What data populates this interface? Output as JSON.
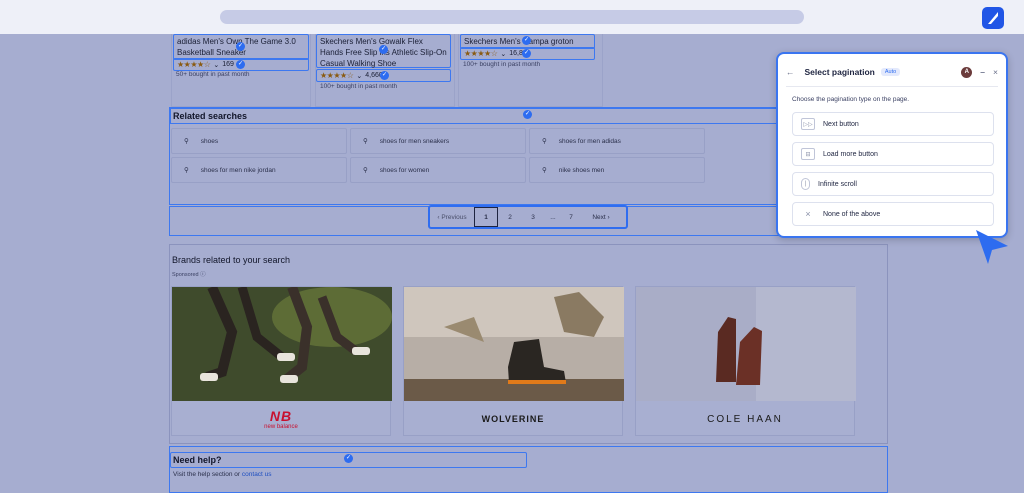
{
  "colors": {
    "accent": "#2d6cf0",
    "page_bg": "#a6add0",
    "panel_bg": "#ffffff",
    "new_balance_red": "#c8102e"
  },
  "products": [
    {
      "title": "adidas Men's Own The Game 3.0 Basketball Sneaker",
      "rating_count": "169",
      "bought": "50+ bought in past month"
    },
    {
      "title": "Skechers Men's Gowalk Flex Hands Free Slip ins Athletic Slip-On Casual Walking Shoe",
      "rating_count": "4,660",
      "bought": "100+ bought in past month"
    },
    {
      "title": "Skechers Men's Nampa groton",
      "rating_count": "16,8..",
      "bought": "100+ bought in past month"
    }
  ],
  "related": {
    "heading": "Related searches",
    "items": [
      "shoes",
      "shoes for men sneakers",
      "shoes for men adidas",
      "shoes for men nike jordan",
      "shoes for women",
      "nike shoes men"
    ]
  },
  "pagination": {
    "previous": "Previous",
    "pages": [
      "1",
      "2",
      "3",
      "...",
      "7"
    ],
    "next": "Next"
  },
  "brands": {
    "heading": "Brands related to your search",
    "sponsored": "Sponsored",
    "items": [
      "new balance",
      "WOLVERINE",
      "COLE HAAN"
    ]
  },
  "help": {
    "heading": "Need help?",
    "text_prefix": "Visit the help section or ",
    "link": "contact us"
  },
  "panel": {
    "title": "Select pagination",
    "badge": "Auto",
    "avatar": "A",
    "prompt": "Choose the pagination type on the page.",
    "options": [
      {
        "label": "Next button",
        "icon": "next-button-icon"
      },
      {
        "label": "Load more button",
        "icon": "load-more-icon"
      },
      {
        "label": "Infinite scroll",
        "icon": "mouse-scroll-icon"
      },
      {
        "label": "None of the above",
        "icon": "close-icon"
      }
    ]
  }
}
